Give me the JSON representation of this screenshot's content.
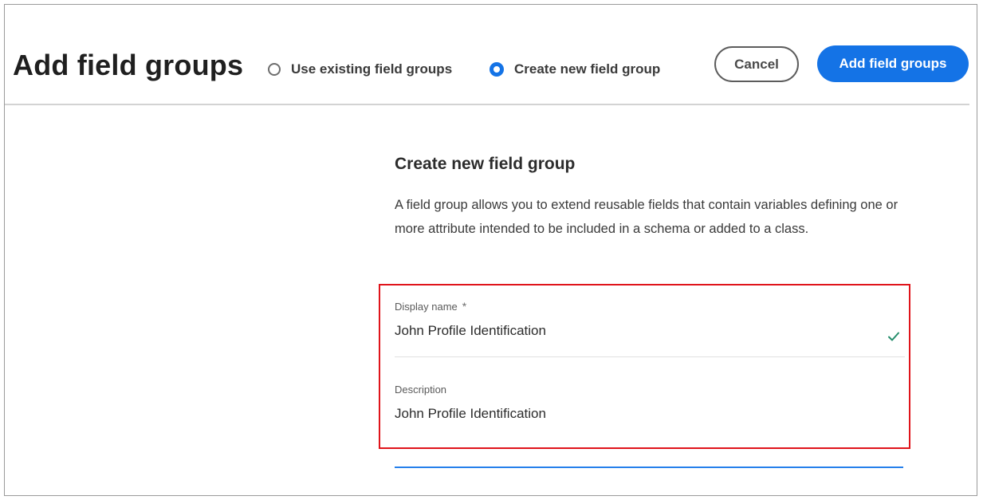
{
  "header": {
    "title": "Add field groups",
    "options": [
      {
        "label": "Use existing field groups",
        "selected": false
      },
      {
        "label": "Create new field group",
        "selected": true
      }
    ],
    "cancel_label": "Cancel",
    "add_label": "Add field groups"
  },
  "form": {
    "heading": "Create new field group",
    "description": "A field group allows you to extend reusable fields that contain variables defining one or more attribute intended to be included in a schema or added to a class.",
    "display_name": {
      "label": "Display name",
      "required_mark": "*",
      "value": "John Profile Identification",
      "status_icon": "checkmark-icon"
    },
    "description_field": {
      "label": "Description",
      "value": "John Profile Identification"
    }
  },
  "colors": {
    "accent": "#1473e6",
    "highlight": "#e0141b",
    "valid": "#268e6c"
  }
}
